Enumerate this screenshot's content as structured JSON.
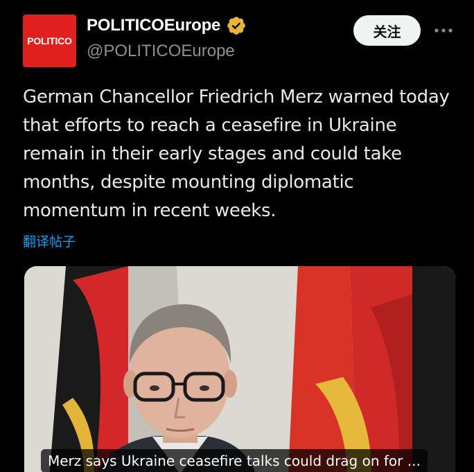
{
  "author": {
    "avatar_text": "POLITICO",
    "display_name": "POLITICOEurope",
    "handle": "@POLITICOEurope",
    "verified": true,
    "avatar_color": "#e0201f",
    "verified_color": "#e8b53b"
  },
  "actions": {
    "follow_label": "关注",
    "more_icon": "more-horizontal-icon"
  },
  "tweet": {
    "text": "German Chancellor Friedrich Merz warned today that efforts to reach a ceasefire in Ukraine remain in their early stages and could take months, despite mounting diplomatic momentum in recent weeks.",
    "translate_label": "翻译帖子"
  },
  "media": {
    "link_caption": "Merz says Ukraine ceasefire talks could drag on for ..."
  },
  "colors": {
    "background": "#000000",
    "text": "#e7e9ea",
    "muted": "#8b9096",
    "link": "#1d9bf0"
  }
}
